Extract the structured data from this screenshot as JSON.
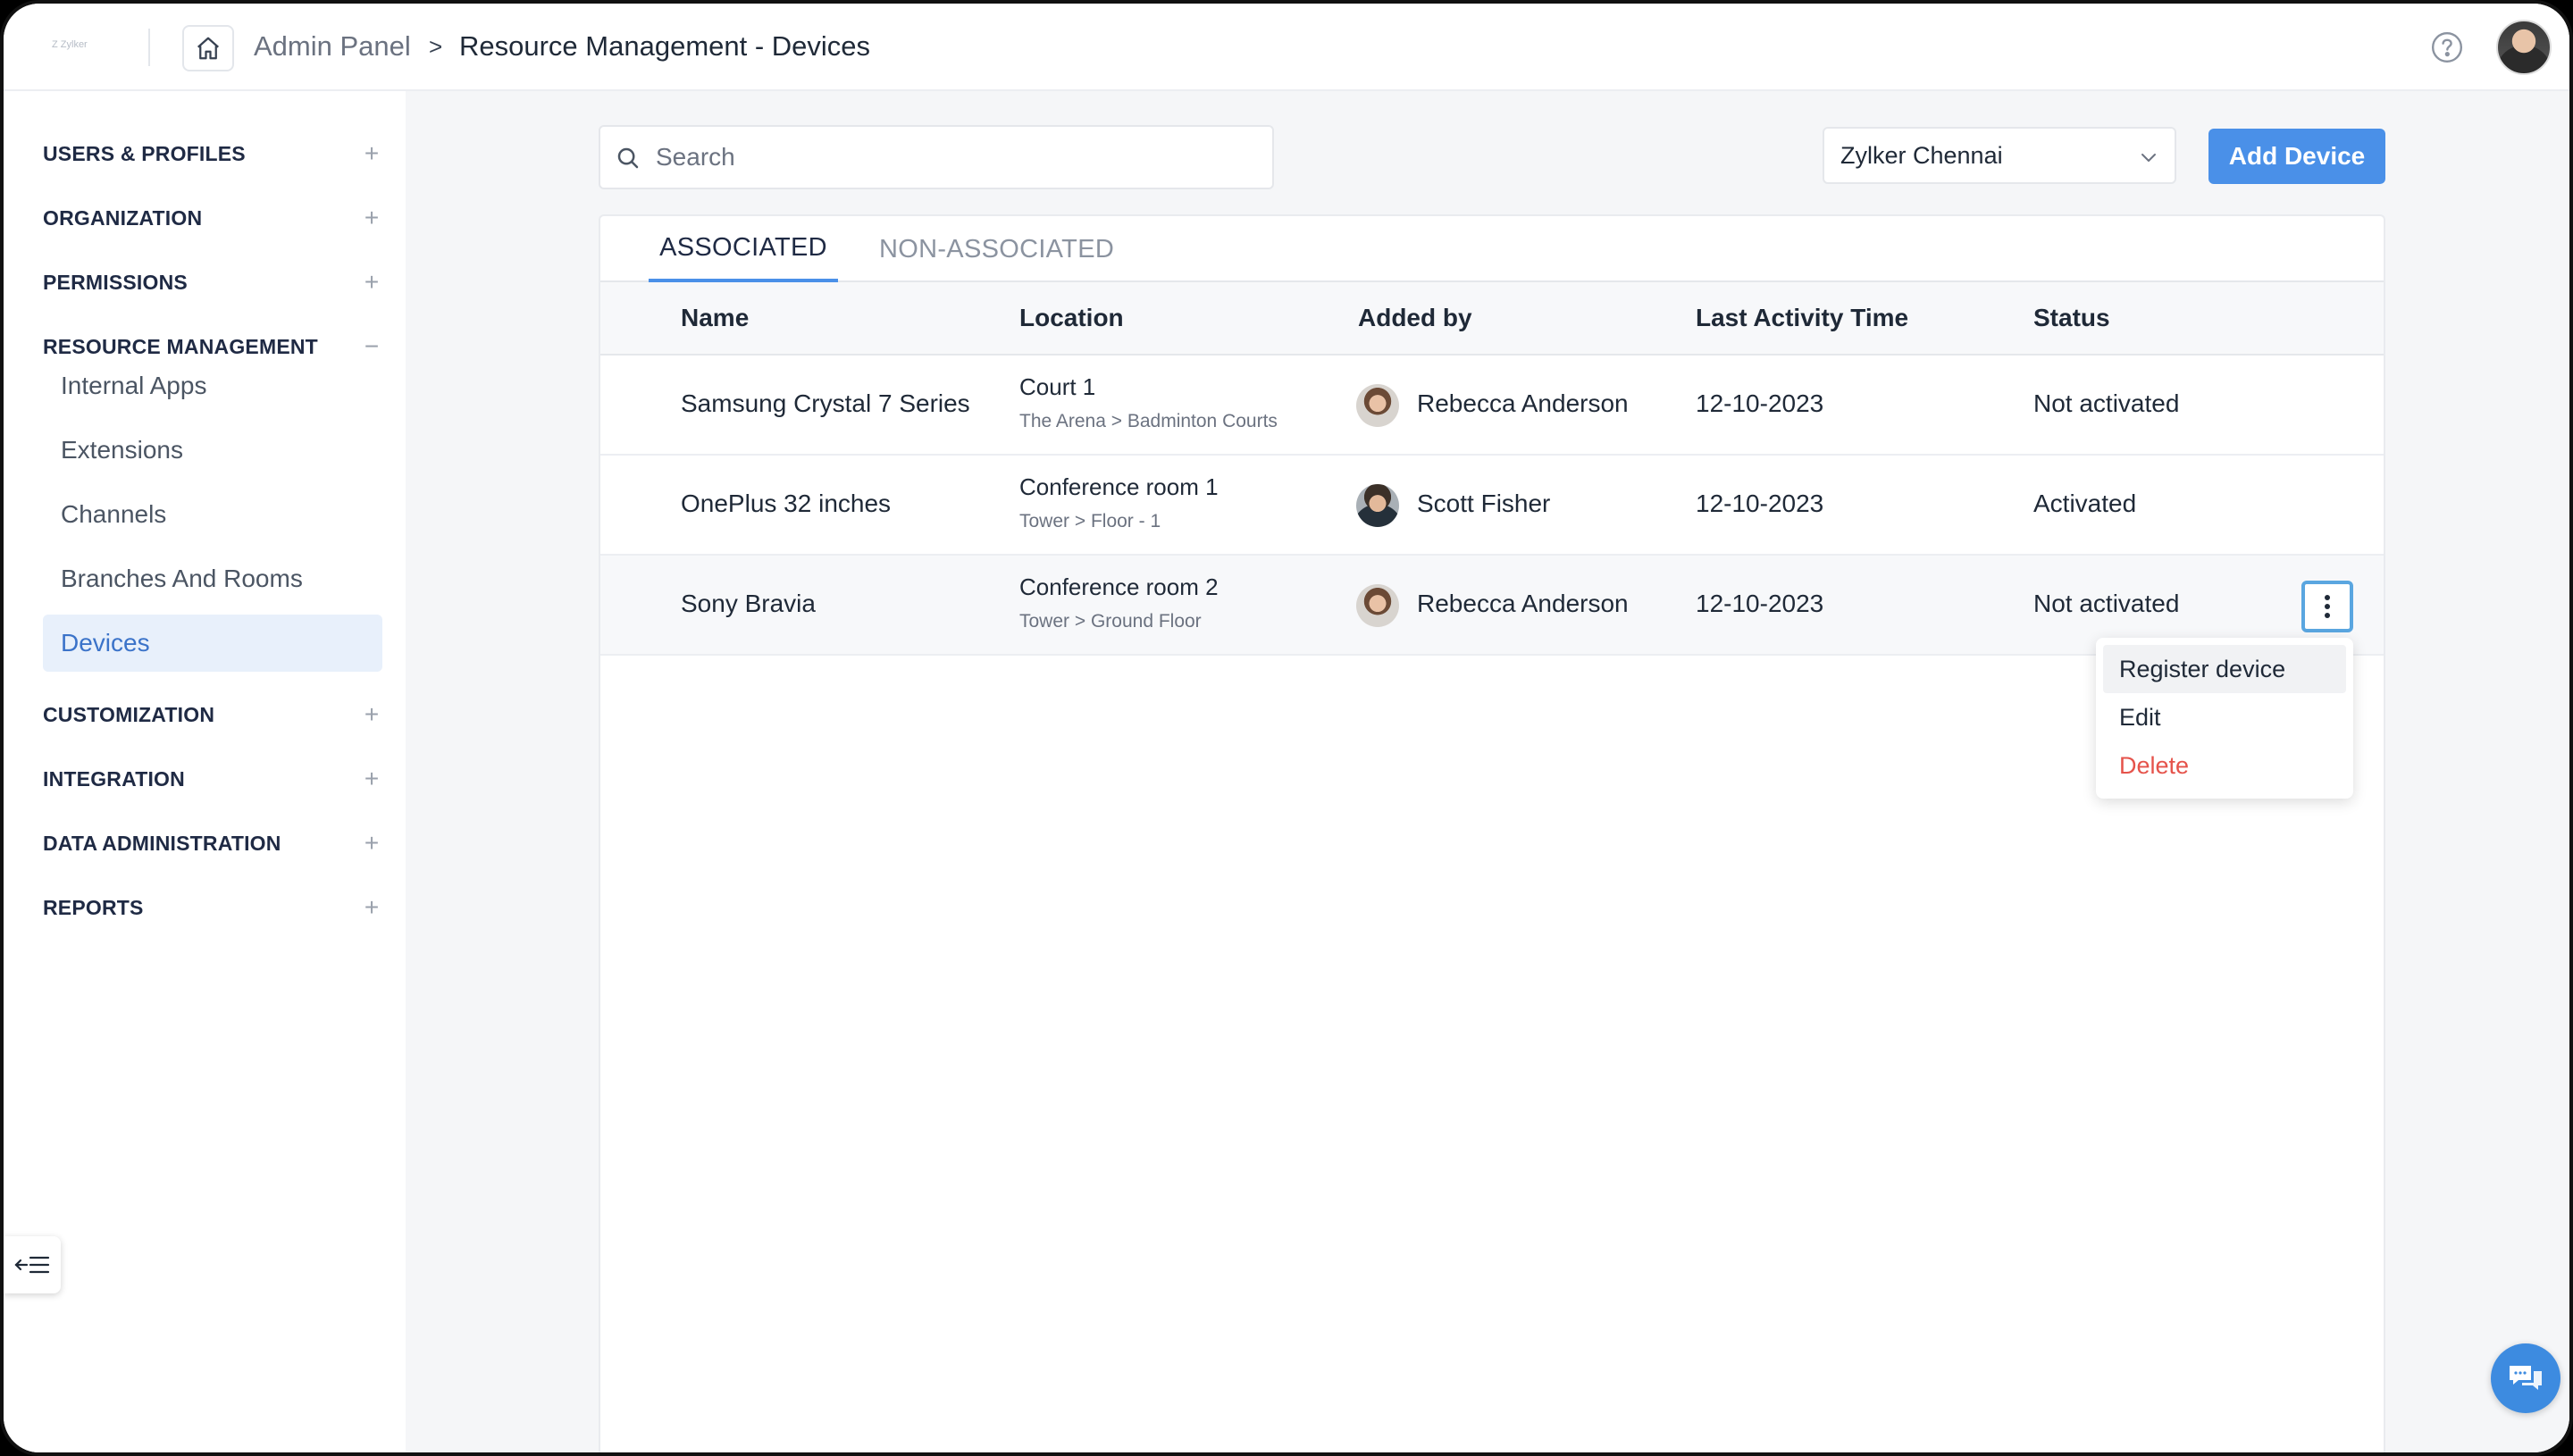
{
  "topbar": {
    "logo_text": "Z Zylker",
    "breadcrumb_root": "Admin Panel",
    "breadcrumb_separator": ">",
    "breadcrumb_current": "Resource Management - Devices"
  },
  "sidebar": {
    "sections": [
      {
        "label": "USERS & PROFILES",
        "toggle": "+"
      },
      {
        "label": "ORGANIZATION",
        "toggle": "+"
      },
      {
        "label": "PERMISSIONS",
        "toggle": "+"
      },
      {
        "label": "RESOURCE MANAGEMENT",
        "toggle": "−"
      },
      {
        "label": "CUSTOMIZATION",
        "toggle": "+"
      },
      {
        "label": "INTEGRATION",
        "toggle": "+"
      },
      {
        "label": "DATA ADMINISTRATION",
        "toggle": "+"
      },
      {
        "label": "REPORTS",
        "toggle": "+"
      }
    ],
    "resource_items": [
      {
        "label": "Internal Apps"
      },
      {
        "label": "Extensions"
      },
      {
        "label": "Channels"
      },
      {
        "label": "Branches And Rooms"
      },
      {
        "label": "Devices",
        "active": true
      }
    ]
  },
  "toolbar": {
    "search_placeholder": "Search",
    "org_select": "Zylker Chennai",
    "add_button": "Add Device"
  },
  "tabs": [
    {
      "label": "ASSOCIATED",
      "active": true
    },
    {
      "label": "NON-ASSOCIATED",
      "active": false
    }
  ],
  "table": {
    "headers": [
      "Name",
      "Location",
      "Added by",
      "Last Activity Time",
      "Status"
    ],
    "rows": [
      {
        "name": "Samsung Crystal 7 Series",
        "location": "Court 1",
        "location_path": "The Arena > Badminton Courts",
        "added_by": "Rebecca Anderson",
        "date": "12-10-2023",
        "status": "Not activated"
      },
      {
        "name": "OnePlus 32 inches",
        "location": "Conference room 1",
        "location_path": "Tower > Floor - 1",
        "added_by": "Scott Fisher",
        "date": "12-10-2023",
        "status": "Activated"
      },
      {
        "name": "Sony Bravia",
        "location": "Conference room 2",
        "location_path": "Tower > Ground Floor",
        "added_by": "Rebecca Anderson",
        "date": "12-10-2023",
        "status": "Not activated"
      }
    ]
  },
  "row_menu": {
    "items": [
      "Register device",
      "Edit",
      "Delete"
    ]
  },
  "colors": {
    "accent": "#4a90e8",
    "danger": "#e5534b",
    "active_nav_bg": "#e8f0fb"
  }
}
